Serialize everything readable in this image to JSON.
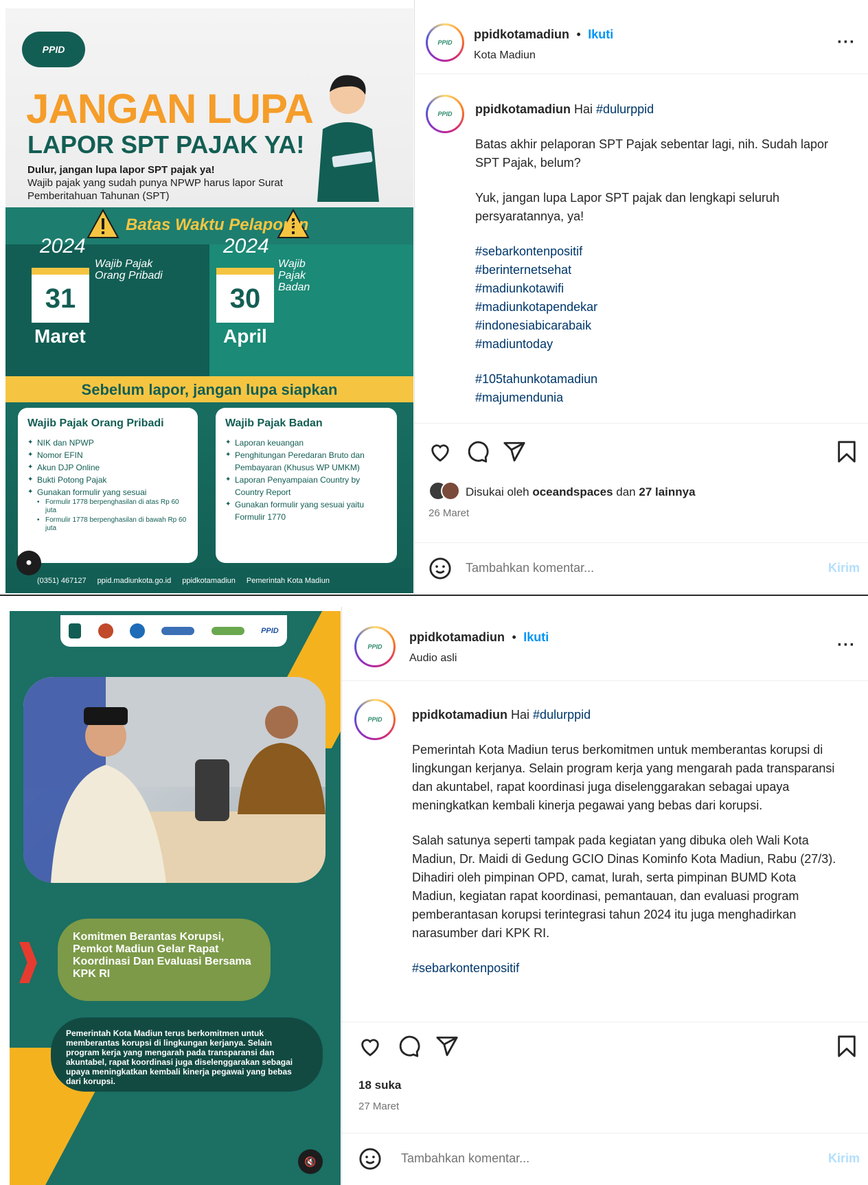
{
  "post1": {
    "poster": {
      "logo": "PPID",
      "title_line1": "JANGAN LUPA",
      "title_line2": "LAPOR SPT PAJAK YA!",
      "desc_bold": "Dulur, jangan lupa lapor SPT pajak ya!",
      "desc": "Wajib pajak yang sudah punya NPWP harus lapor Surat Pemberitahuan Tahunan (SPT)",
      "warning": "Batas Waktu Pelaporan",
      "left": {
        "year": "2024",
        "label": "Wajib Pajak Orang Pribadi",
        "day": "31",
        "month": "Maret"
      },
      "right": {
        "year": "2024",
        "label": "Wajib Pajak Badan",
        "day": "30",
        "month": "April"
      },
      "band": "Sebelum lapor, jangan lupa siapkan",
      "card_left_title": "Wajib Pajak Orang Pribadi",
      "card_left_items": [
        "NIK dan NPWP",
        "Nomor EFIN",
        "Akun DJP Online",
        "Bukti Potong Pajak",
        "Gunakan formulir yang sesuai"
      ],
      "card_left_sub": [
        "Formulir 1778 berpenghasilan di atas Rp 60 juta",
        "Formulir 1778 berpenghasilan di bawah Rp 60 juta"
      ],
      "card_right_title": "Wajib Pajak Badan",
      "card_right_items": [
        "Laporan keuangan",
        "Penghitungan Peredaran Bruto dan Pembayaran (Khusus WP UMKM)",
        "Laporan Penyampaian Country by Country Report",
        "Gunakan formulir yang sesuai yaitu Formulir 1770"
      ],
      "footer": [
        "(0351) 467127",
        "ppid.madiunkota.go.id",
        "ppidkotamadiun",
        "Pemerintah Kota Madiun"
      ]
    },
    "header": {
      "username": "ppidkotamadiun",
      "dot": "•",
      "follow": "Ikuti",
      "subline": "Kota Madiun"
    },
    "caption": {
      "username": "ppidkotamadiun",
      "greeting": "Hai",
      "greeting_tag": "#dulurppid",
      "paragraph1": "Batas akhir pelaporan SPT Pajak sebentar lagi, nih. Sudah lapor SPT Pajak, belum?",
      "paragraph2": "Yuk, jangan lupa Lapor SPT pajak dan lengkapi seluruh persyaratannya, ya!",
      "tags1": [
        "#sebarkontenpositif",
        "#berinternetsehat",
        "#madiunkotawifi",
        "#madiunkotapendekar",
        "#indonesiabicarabaik",
        "#madiuntoday"
      ],
      "tags2": [
        "#105tahunkotamadiun",
        "#majumendunia"
      ]
    },
    "likes_prefix": "Disukai oleh",
    "likes_user": "oceandspaces",
    "likes_mid": "dan",
    "likes_others": "27 lainnya",
    "date": "26 Maret",
    "comment_placeholder": "Tambahkan komentar...",
    "send": "Kirim"
  },
  "post2": {
    "poster": {
      "logos": [
        "PPID"
      ],
      "headline": "Komitmen Berantas Korupsi, Pemkot Madiun Gelar Rapat Koordinasi Dan Evaluasi Bersama KPK RI",
      "body": "Pemerintah Kota Madiun terus berkomitmen untuk memberantas korupsi di lingkungan kerjanya. Selain program kerja yang mengarah pada transparansi dan akuntabel, rapat koordinasi juga diselenggarakan sebagai upaya meningkatkan kembali kinerja pegawai yang bebas dari korupsi."
    },
    "header": {
      "username": "ppidkotamadiun",
      "dot": "•",
      "follow": "Ikuti",
      "subline": "Audio asli"
    },
    "caption": {
      "username": "ppidkotamadiun",
      "greeting": "Hai",
      "greeting_tag": "#dulurppid",
      "paragraph1": "Pemerintah Kota Madiun terus berkomitmen untuk memberantas korupsi di lingkungan kerjanya. Selain program kerja yang mengarah pada transparansi dan akuntabel, rapat koordinasi juga diselenggarakan sebagai upaya meningkatkan kembali kinerja pegawai yang bebas dari korupsi.",
      "paragraph2": "Salah satunya seperti tampak pada kegiatan yang dibuka oleh Wali Kota Madiun, Dr. Maidi di Gedung GCIO Dinas Kominfo Kota Madiun, Rabu (27/3). Dihadiri oleh pimpinan OPD, camat, lurah, serta pimpinan BUMD Kota Madiun, kegiatan rapat koordinasi, pemantauan, dan evaluasi program pemberantasan korupsi terintegrasi tahun 2024 itu juga menghadirkan narasumber dari KPK RI.",
      "tags1": [
        "#sebarkontenpositif"
      ]
    },
    "likes": "18 suka",
    "date": "27 Maret",
    "comment_placeholder": "Tambahkan komentar...",
    "send": "Kirim"
  },
  "icons": [
    "heart-icon",
    "comment-icon",
    "share-icon",
    "bookmark-icon",
    "more-icon",
    "emoji-icon",
    "mute-icon",
    "user-icon",
    "warning-icon"
  ]
}
